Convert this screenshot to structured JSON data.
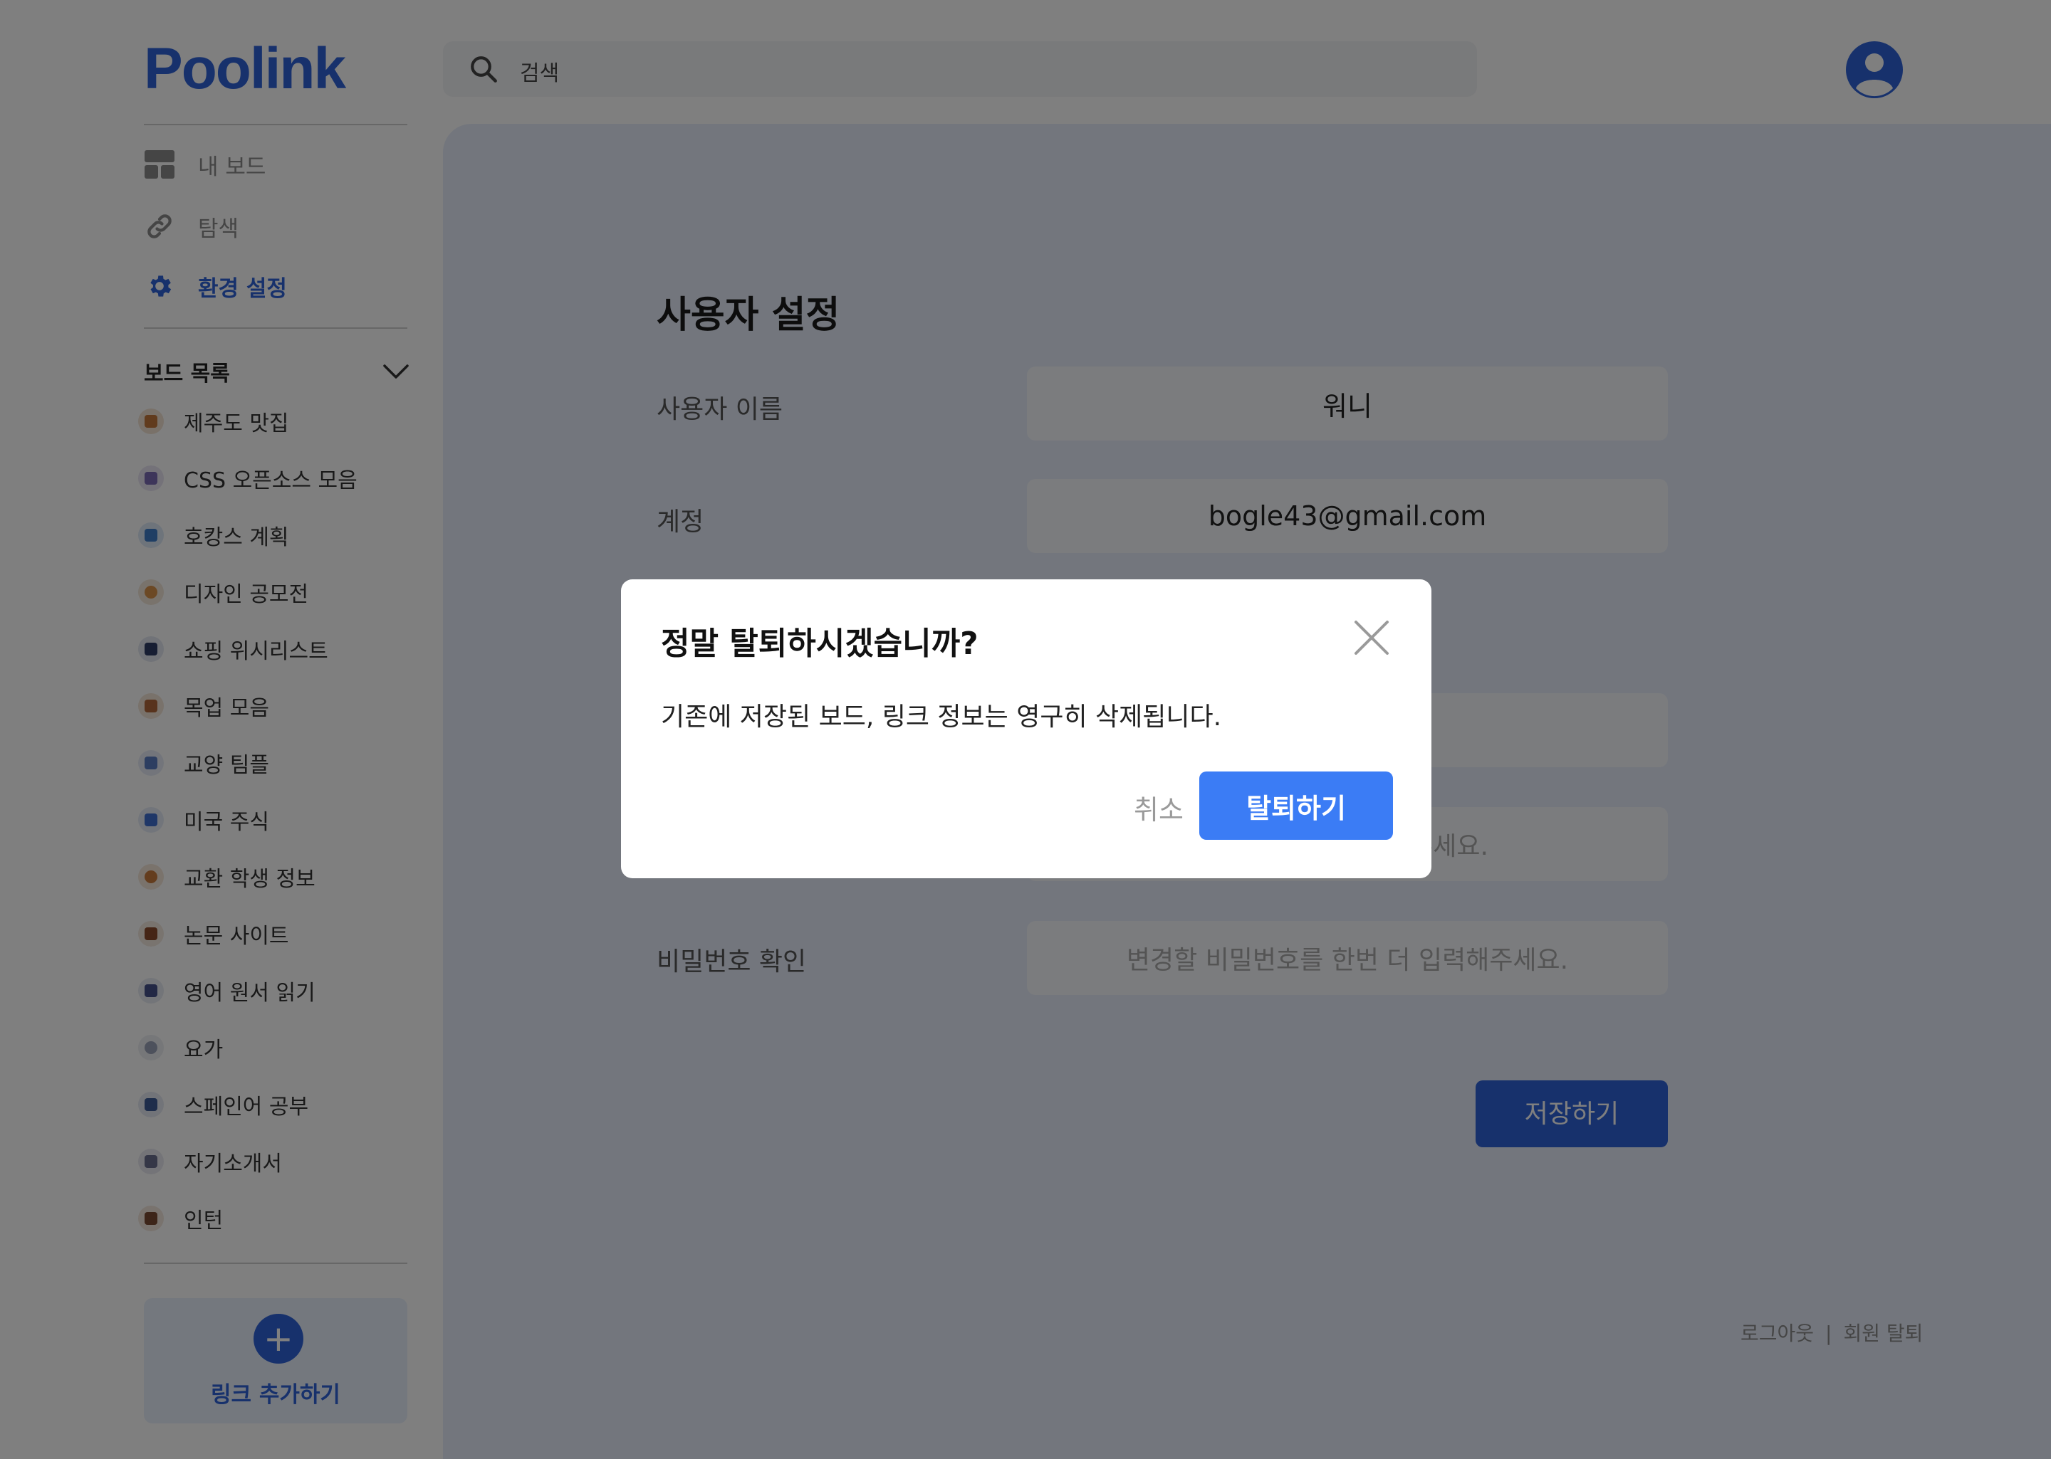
{
  "app": {
    "logo": "Poolink"
  },
  "search": {
    "placeholder": "검색"
  },
  "nav": {
    "items": [
      {
        "label": "내 보드",
        "icon": "board-icon"
      },
      {
        "label": "탐색",
        "icon": "link-icon"
      },
      {
        "label": "환경 설정",
        "icon": "gear-icon",
        "active": true
      }
    ]
  },
  "boards": {
    "title": "보드 목록",
    "items": [
      {
        "name": "제주도 맛집"
      },
      {
        "name": "CSS 오픈소스 모음"
      },
      {
        "name": "호캉스 계획"
      },
      {
        "name": "디자인 공모전"
      },
      {
        "name": "쇼핑 위시리스트"
      },
      {
        "name": "목업 모음"
      },
      {
        "name": "교양 팀플"
      },
      {
        "name": "미국 주식"
      },
      {
        "name": "교환 학생 정보"
      },
      {
        "name": "논문 사이트"
      },
      {
        "name": "영어 원서 읽기"
      },
      {
        "name": "요가"
      },
      {
        "name": "스페인어 공부"
      },
      {
        "name": "자기소개서"
      },
      {
        "name": "인턴"
      }
    ]
  },
  "add_link": {
    "plus": "+",
    "label": "링크 추가하기"
  },
  "settings": {
    "title": "사용자 설정",
    "username_label": "사용자 이름",
    "username_value": "워니",
    "account_label": "계정",
    "account_value": "bogle43@gmail.com",
    "password_hint_partial": "해주세요.",
    "confirm_label": "비밀번호 확인",
    "confirm_placeholder": "변경할 비밀번호를 한번 더 입력해주세요.",
    "save_label": "저장하기"
  },
  "footer": {
    "logout": "로그아웃",
    "separator": "|",
    "withdraw": "회원 탈퇴"
  },
  "modal": {
    "title": "정말 탈퇴하시겠습니까?",
    "message": "기존에 저장된 보드, 링크 정보는 영구히 삭제됩니다.",
    "cancel": "취소",
    "confirm": "탈퇴하기"
  },
  "colors": {
    "brand": "#2e62d9",
    "confirm_button": "#3b7cf5",
    "panel": "#e6edfa"
  }
}
